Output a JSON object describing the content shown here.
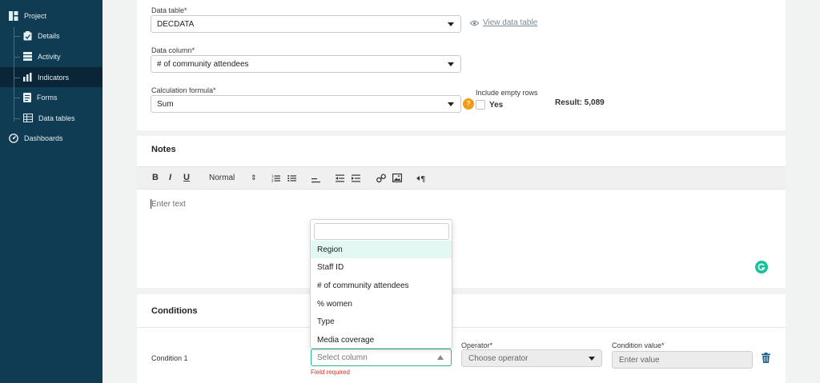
{
  "sidebar": {
    "items": [
      {
        "label": "Project",
        "icon": "project-icon"
      },
      {
        "label": "Details",
        "icon": "clipboard-icon"
      },
      {
        "label": "Activity",
        "icon": "activity-icon"
      },
      {
        "label": "Indicators",
        "icon": "bar-chart-icon"
      },
      {
        "label": "Forms",
        "icon": "form-icon"
      },
      {
        "label": "Data tables",
        "icon": "table-icon"
      },
      {
        "label": "Dashboards",
        "icon": "dashboard-icon"
      }
    ],
    "active": "Indicators"
  },
  "form": {
    "data_table_label": "Data table*",
    "data_table_value": "DECDATA",
    "view_data_table": "View data table",
    "data_column_label": "Data column*",
    "data_column_value": "# of community attendees",
    "calc_label": "Calculation formula*",
    "calc_value": "Sum",
    "help_glyph": "?",
    "include_empty_label": "Include empty rows",
    "include_empty_option": "Yes",
    "result": "Result: 5,089"
  },
  "notes": {
    "title": "Notes",
    "toolbar": {
      "bold": "B",
      "italic": "I",
      "underline": "U",
      "format": "Normal",
      "format_arrow": "⇕"
    },
    "placeholder": "Enter text"
  },
  "conditions": {
    "title": "Conditions",
    "condition_label": "Condition 1",
    "column_placeholder": "Select column",
    "field_error": "Field required",
    "operator_label": "Operator*",
    "operator_placeholder": "Choose operator",
    "value_label": "Condition value*",
    "value_placeholder": "Enter value"
  },
  "dropdown": {
    "options": [
      "Region",
      "Staff ID",
      "# of community attendees",
      "% women",
      "Type",
      "Media coverage"
    ],
    "highlighted": "Region"
  },
  "colors": {
    "sidebar_bg": "#0f3b53",
    "accent_teal": "#29b39b",
    "help_orange": "#f39c12",
    "error_red": "#d0352b",
    "trash_blue": "#1f5f8a"
  }
}
